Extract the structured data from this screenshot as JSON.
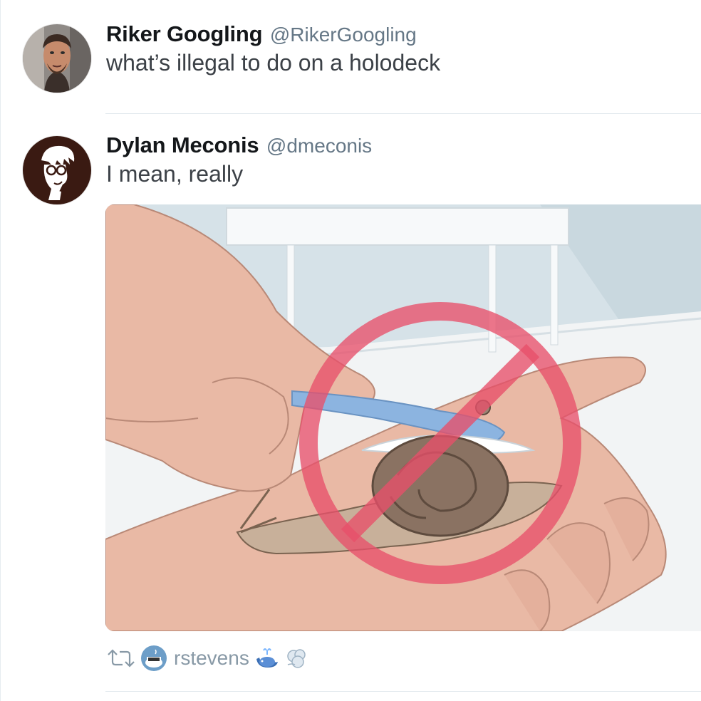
{
  "tweets": [
    {
      "name": "Riker Googling",
      "handle": "@RikerGoogling",
      "text": "what’s illegal to do on a holodeck",
      "avatar_icon": "person-photo-avatar"
    },
    {
      "name": "Dylan Meconis",
      "handle": "@dmeconis",
      "text": "I mean, really",
      "avatar_icon": "cartoon-glasses-avatar",
      "media": {
        "description_icon": "hand-brushing-snail-with-prohibition-sign",
        "accent": "#e8506a"
      }
    }
  ],
  "retweeted_by": {
    "name": "rstevens",
    "icon": "retweet-icon",
    "emojis": [
      "whale-emoji",
      "dash-emoji"
    ]
  },
  "colors": {
    "name": "#14171a",
    "handle": "#657786",
    "divider": "#e1e8ed"
  }
}
